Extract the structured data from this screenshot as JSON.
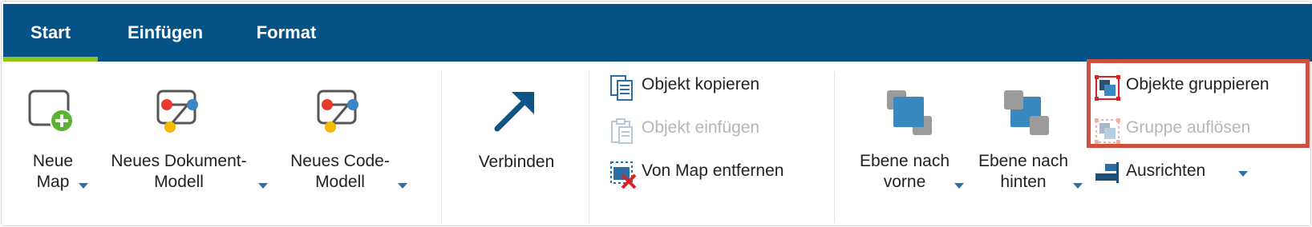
{
  "tabs": [
    {
      "label": "Start",
      "active": true
    },
    {
      "label": "Einfügen",
      "active": false
    },
    {
      "label": "Format",
      "active": false
    }
  ],
  "colors": {
    "tab_bar": "#045286",
    "active_tab_indicator": "#8bc21d",
    "highlight_box": "#cd5040",
    "icon_blue": "#2d6ea5",
    "disabled_text": "#b6b6b6"
  },
  "ribbon": {
    "new_map": {
      "label": "Neue\nMap",
      "icon": "new-map-icon",
      "has_dropdown": true
    },
    "new_document_model": {
      "label": "Neues Dokument-\nModell",
      "icon": "document-model-icon",
      "has_dropdown": true
    },
    "new_code_model": {
      "label": "Neues Code-\nModell",
      "icon": "code-model-icon",
      "has_dropdown": true
    },
    "connect": {
      "label": "Verbinden",
      "icon": "arrow-up-right-icon"
    },
    "copy_object": {
      "label": "Objekt kopieren",
      "icon": "copy-icon",
      "enabled": true
    },
    "paste_object": {
      "label": "Objekt einfügen",
      "icon": "paste-icon",
      "enabled": false
    },
    "remove_from_map": {
      "label": "Von Map entfernen",
      "icon": "remove-from-map-icon",
      "enabled": true
    },
    "bring_forward": {
      "label": "Ebene nach\nvorne",
      "icon": "bring-forward-icon",
      "has_dropdown": true
    },
    "send_backward": {
      "label": "Ebene nach\nhinten",
      "icon": "send-backward-icon",
      "has_dropdown": true
    },
    "group_objects": {
      "label": "Objekte gruppieren",
      "icon": "group-icon",
      "enabled": true
    },
    "ungroup": {
      "label": "Gruppe auflösen",
      "icon": "ungroup-icon",
      "enabled": false
    },
    "align": {
      "label": "Ausrichten",
      "icon": "align-icon",
      "has_dropdown": true
    }
  }
}
